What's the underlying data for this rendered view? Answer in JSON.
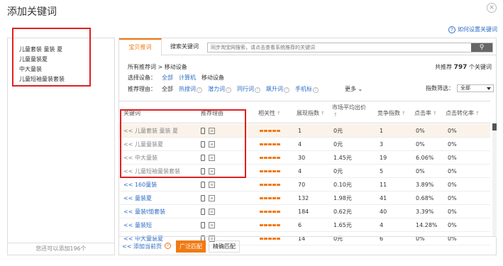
{
  "dialog": {
    "title": "添加关键词",
    "close_symbol": "×",
    "help_link": "如何设置关键词",
    "help_symbol": "?"
  },
  "left": {
    "items": [
      "儿童套装 童装 夏",
      "儿童童装夏",
      "中大童装",
      "儿童短袖童装套装"
    ],
    "footer": "您还可以添加196个"
  },
  "tabs": {
    "recommend": "宝贝推词",
    "search": "搜索关键词"
  },
  "search": {
    "placeholder": "同步淘宝网搜索，请点击查看系统推荐的关键词",
    "icon": "search-icon"
  },
  "crumb": "所有推荐词 > 移动设备",
  "total": {
    "prefix": "共推荐",
    "count": "797",
    "suffix": "个关键词"
  },
  "device": {
    "label": "选择设备：",
    "options": [
      "全部",
      "计算机",
      "移动设备"
    ]
  },
  "reason": {
    "label": "推荐理由：",
    "options": [
      "全部",
      "热搜词",
      "潜力词",
      "同行词",
      "飙升词",
      "手机标"
    ],
    "more": "更多"
  },
  "filter": {
    "label": "指数筛选：",
    "value": "全部"
  },
  "columns": [
    "关键词",
    "推荐理由",
    "相关性",
    "展现指数",
    "市场平均出价",
    "竞争指数",
    "点击率",
    "点击转化率"
  ],
  "rows": [
    {
      "kw": "<< 儿童套装 童装 夏",
      "show": "1",
      "price": "0元",
      "comp": "1",
      "ctr": "0%",
      "cvr": "0%"
    },
    {
      "kw": "<< 儿童童装夏",
      "show": "4",
      "price": "0元",
      "comp": "3",
      "ctr": "0%",
      "cvr": "0%"
    },
    {
      "kw": "<< 中大童装",
      "show": "30",
      "price": "1.45元",
      "comp": "19",
      "ctr": "6.06%",
      "cvr": "0%"
    },
    {
      "kw": "<< 儿童短袖童装套装",
      "show": "4",
      "price": "0元",
      "comp": "5",
      "ctr": "0%",
      "cvr": "0%"
    },
    {
      "kw": "<< 160童装",
      "show": "70",
      "price": "0.10元",
      "comp": "11",
      "ctr": "3.89%",
      "cvr": "0%"
    },
    {
      "kw": "<< 童装夏",
      "show": "132",
      "price": "1.98元",
      "comp": "41",
      "ctr": "0.68%",
      "cvr": "0%"
    },
    {
      "kw": "<< 童装t恤套装",
      "show": "184",
      "price": "0.62元",
      "comp": "40",
      "ctr": "3.39%",
      "cvr": "0%"
    },
    {
      "kw": "<< 童装短",
      "show": "6",
      "price": "1.65元",
      "comp": "4",
      "ctr": "14.28%",
      "cvr": "0%"
    },
    {
      "kw": "<< 中大童装夏",
      "show": "14",
      "price": "0元",
      "comp": "6",
      "ctr": "0%",
      "cvr": "0%"
    }
  ],
  "footer": {
    "add_page": "<< 添加当前页",
    "broad": "广泛匹配",
    "exact": "精确匹配",
    "q": "?"
  },
  "colors": {
    "accent": "#f07a14",
    "link": "#2f6ec5",
    "highlight_box": "#e02020"
  }
}
